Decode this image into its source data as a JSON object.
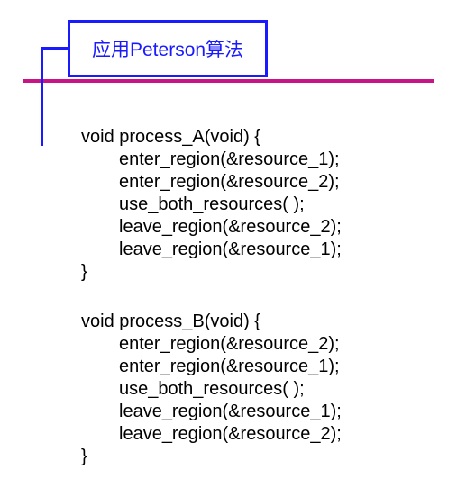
{
  "header": {
    "title": "应用Peterson算法"
  },
  "code_a": {
    "signature": "void process_A(void) {",
    "line1": "enter_region(&resource_1);",
    "line2": "enter_region(&resource_2);",
    "line3": "use_both_resources( );",
    "line4": "leave_region(&resource_2);",
    "line5": "leave_region(&resource_1);",
    "close": "}"
  },
  "code_b": {
    "signature": "void process_B(void) {",
    "line1": "enter_region(&resource_2);",
    "line2": "enter_region(&resource_1);",
    "line3": "use_both_resources( );",
    "line4": "leave_region(&resource_1);",
    "line5": "leave_region(&resource_2);",
    "close": "}"
  }
}
